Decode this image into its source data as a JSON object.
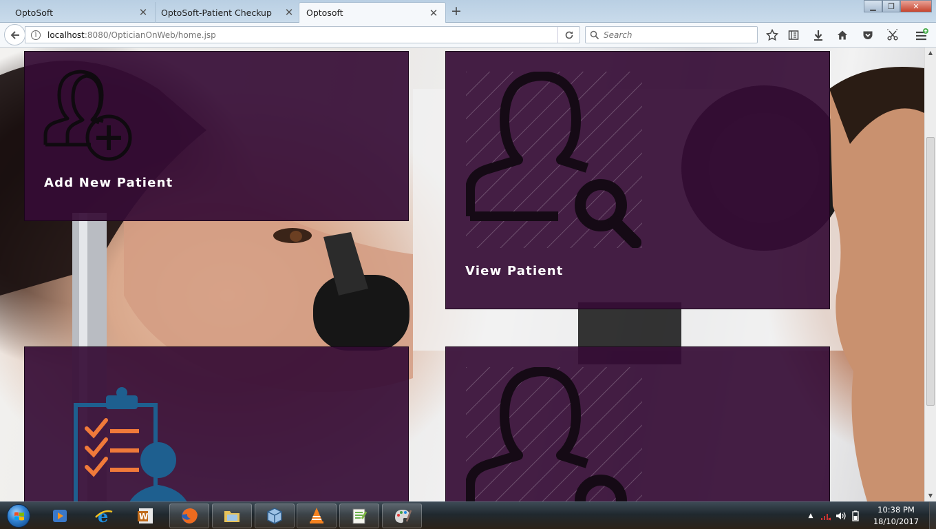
{
  "tabs": [
    {
      "title": "OptoSoft",
      "active": false
    },
    {
      "title": "OptoSoft-Patient Checkup",
      "active": false
    },
    {
      "title": "Optosoft",
      "active": true
    }
  ],
  "nav": {
    "url_host": "localhost",
    "url_rest": ":8080/OpticianOnWeb/home.jsp",
    "search_placeholder": "Search"
  },
  "tiles": {
    "add_patient": "Add New Patient",
    "view_patient": "View Patient"
  },
  "taskbar": {
    "time": "10:38 PM",
    "date": "18/10/2017"
  },
  "colors": {
    "tile_background": "#350c35",
    "tile_label": "#ffffff",
    "checklist_blue": "#1e5f8f",
    "checklist_orange": "#f07a3a"
  },
  "icons": [
    "add-user-icon",
    "search-user-icon",
    "checklist-patient-icon"
  ]
}
